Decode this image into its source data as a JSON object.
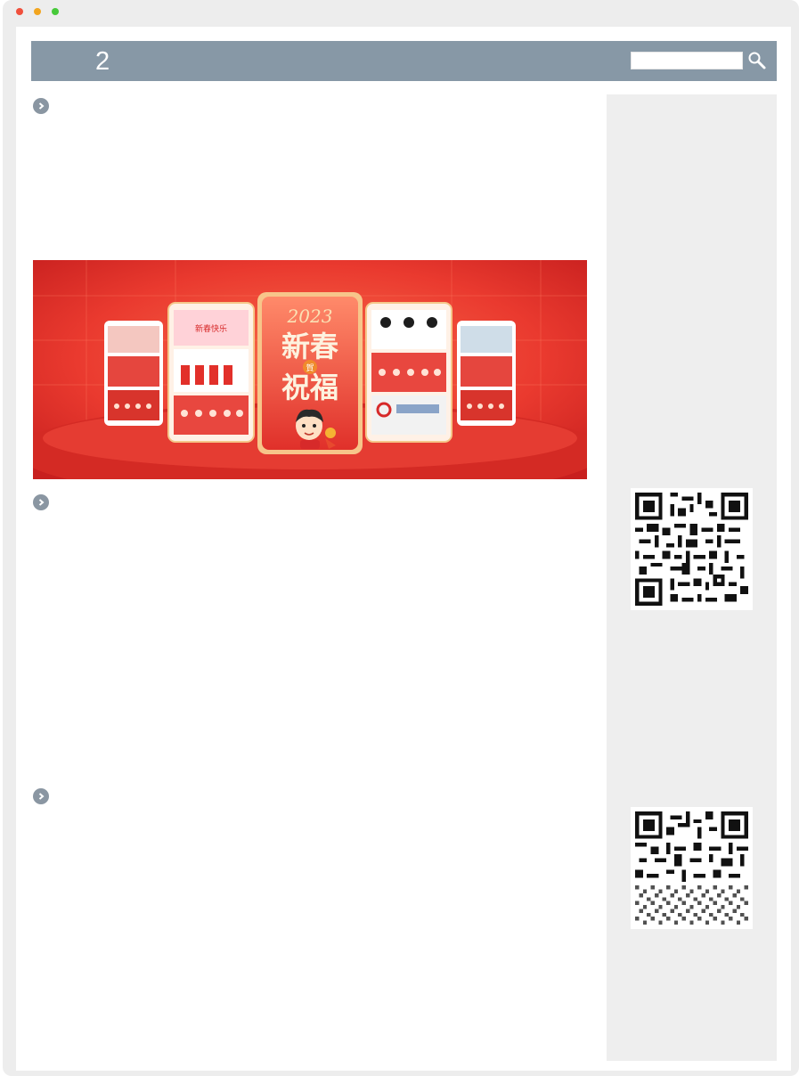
{
  "header": {
    "title": "2",
    "search": {
      "value": "",
      "placeholder": ""
    }
  },
  "banner": {
    "year": "2023",
    "line1": "新春",
    "badge": "賀",
    "line2": "祝福"
  },
  "sections": [
    {
      "icon": "chevron-right-icon"
    },
    {
      "icon": "chevron-right-icon"
    },
    {
      "icon": "chevron-right-icon"
    }
  ],
  "sidebar": {
    "qr_codes": [
      "qr-code",
      "qr-code"
    ]
  },
  "colors": {
    "header_bg": "#8798a6",
    "bullet": "#8a96a2",
    "sidebar_bg": "#eeeeee",
    "banner_red": "#e8322b"
  }
}
